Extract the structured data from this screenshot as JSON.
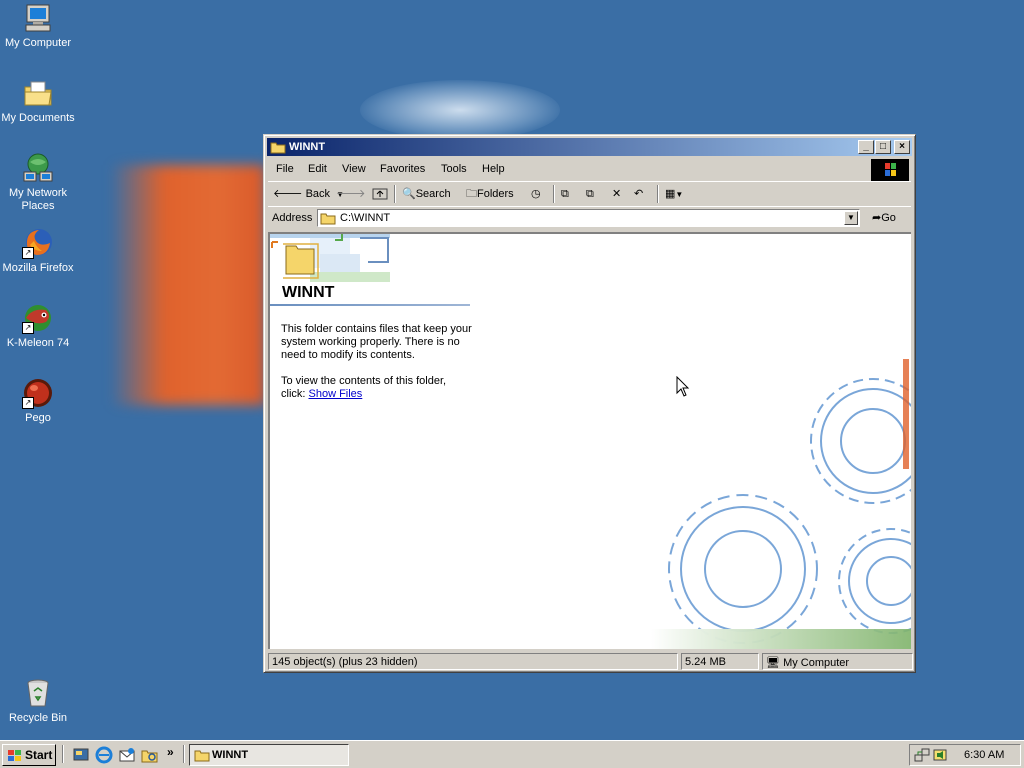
{
  "desktop": {
    "icons": [
      {
        "label": "My Computer",
        "icon": "my-computer-icon"
      },
      {
        "label": "My Documents",
        "icon": "my-documents-icon"
      },
      {
        "label": "My Network Places",
        "icon": "network-places-icon"
      },
      {
        "label": "Mozilla Firefox",
        "icon": "firefox-icon"
      },
      {
        "label": "K-Meleon 74",
        "icon": "k-meleon-icon"
      },
      {
        "label": "Pego",
        "icon": "pego-icon"
      },
      {
        "label": "Recycle Bin",
        "icon": "recycle-bin-icon"
      }
    ]
  },
  "window": {
    "title": "WINNT",
    "menu": [
      "File",
      "Edit",
      "View",
      "Favorites",
      "Tools",
      "Help"
    ],
    "toolbar": {
      "back": "Back",
      "search": "Search",
      "folders": "Folders"
    },
    "address": {
      "label": "Address",
      "value": "C:\\WINNT",
      "go": "Go"
    },
    "content": {
      "folder_title": "WINNT",
      "info": "This folder contains files that keep your system working properly. There is no need to modify its contents.",
      "view_prompt": "To view the contents of this folder, click: ",
      "show_files": "Show Files"
    },
    "status": {
      "objects": "145 object(s) (plus 23 hidden)",
      "size": "5.24 MB",
      "location": "My Computer"
    }
  },
  "taskbar": {
    "start": "Start",
    "task": "WINNT",
    "chevron": "»",
    "clock": "6:30 AM"
  },
  "colors": {
    "desktop": "#3a6ea5",
    "titlebar_start": "#0a246a",
    "titlebar_end": "#a6caf0",
    "face": "#d4d0c8"
  }
}
